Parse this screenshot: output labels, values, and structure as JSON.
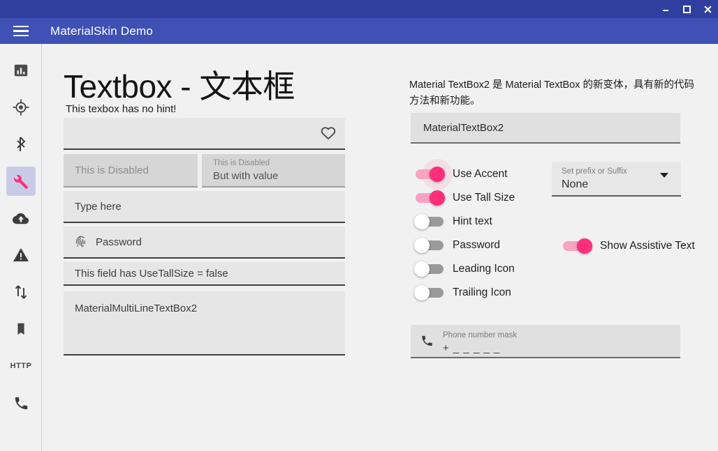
{
  "window": {
    "title": "MaterialSkin Demo",
    "controls": [
      {
        "name": "minimize",
        "glyph": "minimize-icon"
      },
      {
        "name": "maximize",
        "glyph": "maximize-icon"
      },
      {
        "name": "close",
        "glyph": "close-icon"
      }
    ],
    "titlebar_color": "#303f9f",
    "appbar_color": "#3f51b5"
  },
  "sidebar": {
    "items": [
      {
        "icon": "bar-chart-icon",
        "selected": false
      },
      {
        "icon": "gps-fixed-icon",
        "selected": false
      },
      {
        "icon": "bluetooth-icon",
        "selected": false
      },
      {
        "icon": "wrench-icon",
        "selected": true
      },
      {
        "icon": "cloud-upload-icon",
        "selected": false
      },
      {
        "icon": "warning-icon",
        "selected": false
      },
      {
        "icon": "swap-vertical-icon",
        "selected": false
      },
      {
        "icon": "bookmark-icon",
        "selected": false
      },
      {
        "icon": "http-icon",
        "label": "HTTP",
        "selected": false
      },
      {
        "icon": "phone-icon",
        "selected": false
      }
    ],
    "selected_bg": "#c8cbe8",
    "accent": "#ff2e7a"
  },
  "page": {
    "title": "Textbox - 文本框",
    "subtitle": "This texbox has no hint!"
  },
  "left_fields": {
    "no_hint": {
      "value": "",
      "trailing_icon": "heart-icon"
    },
    "disabled_plain": {
      "value": "This is Disabled",
      "hint": ""
    },
    "disabled_with_value": {
      "hint": "This is Disabled",
      "value": "But with value"
    },
    "type_here": {
      "value": "Type here"
    },
    "password": {
      "value": "Password",
      "leading_icon": "fingerprint-icon"
    },
    "use_tall_false": {
      "value": "This field has UseTallSize = false"
    },
    "multiline": {
      "value": "MaterialMultiLineTextBox2"
    }
  },
  "right_panel": {
    "description": "Material TextBox2 是 Material TextBox 的新变体，具有新的代码方法和新功能。",
    "textbox2": {
      "value": "MaterialTextBox2"
    },
    "switches": [
      {
        "label": "Use Accent",
        "on": true,
        "focus_halo": true
      },
      {
        "label": "Use Tall Size",
        "on": true,
        "focus_halo": false
      },
      {
        "label": "Hint text",
        "on": false,
        "focus_halo": false
      },
      {
        "label": "Password",
        "on": false,
        "focus_halo": false
      },
      {
        "label": "Leading Icon",
        "on": false,
        "focus_halo": false
      },
      {
        "label": "Trailing Icon",
        "on": false,
        "focus_halo": false
      }
    ],
    "prefix_dropdown": {
      "label": "Set prefix or Suffix",
      "value": "None",
      "options": [
        "None"
      ]
    },
    "assistive_switch": {
      "label": "Show Assistive Text",
      "on": true
    },
    "phone_field": {
      "label": "Phone number mask",
      "value": "+ _ _  _  _  _",
      "leading_icon": "phone-icon"
    }
  }
}
